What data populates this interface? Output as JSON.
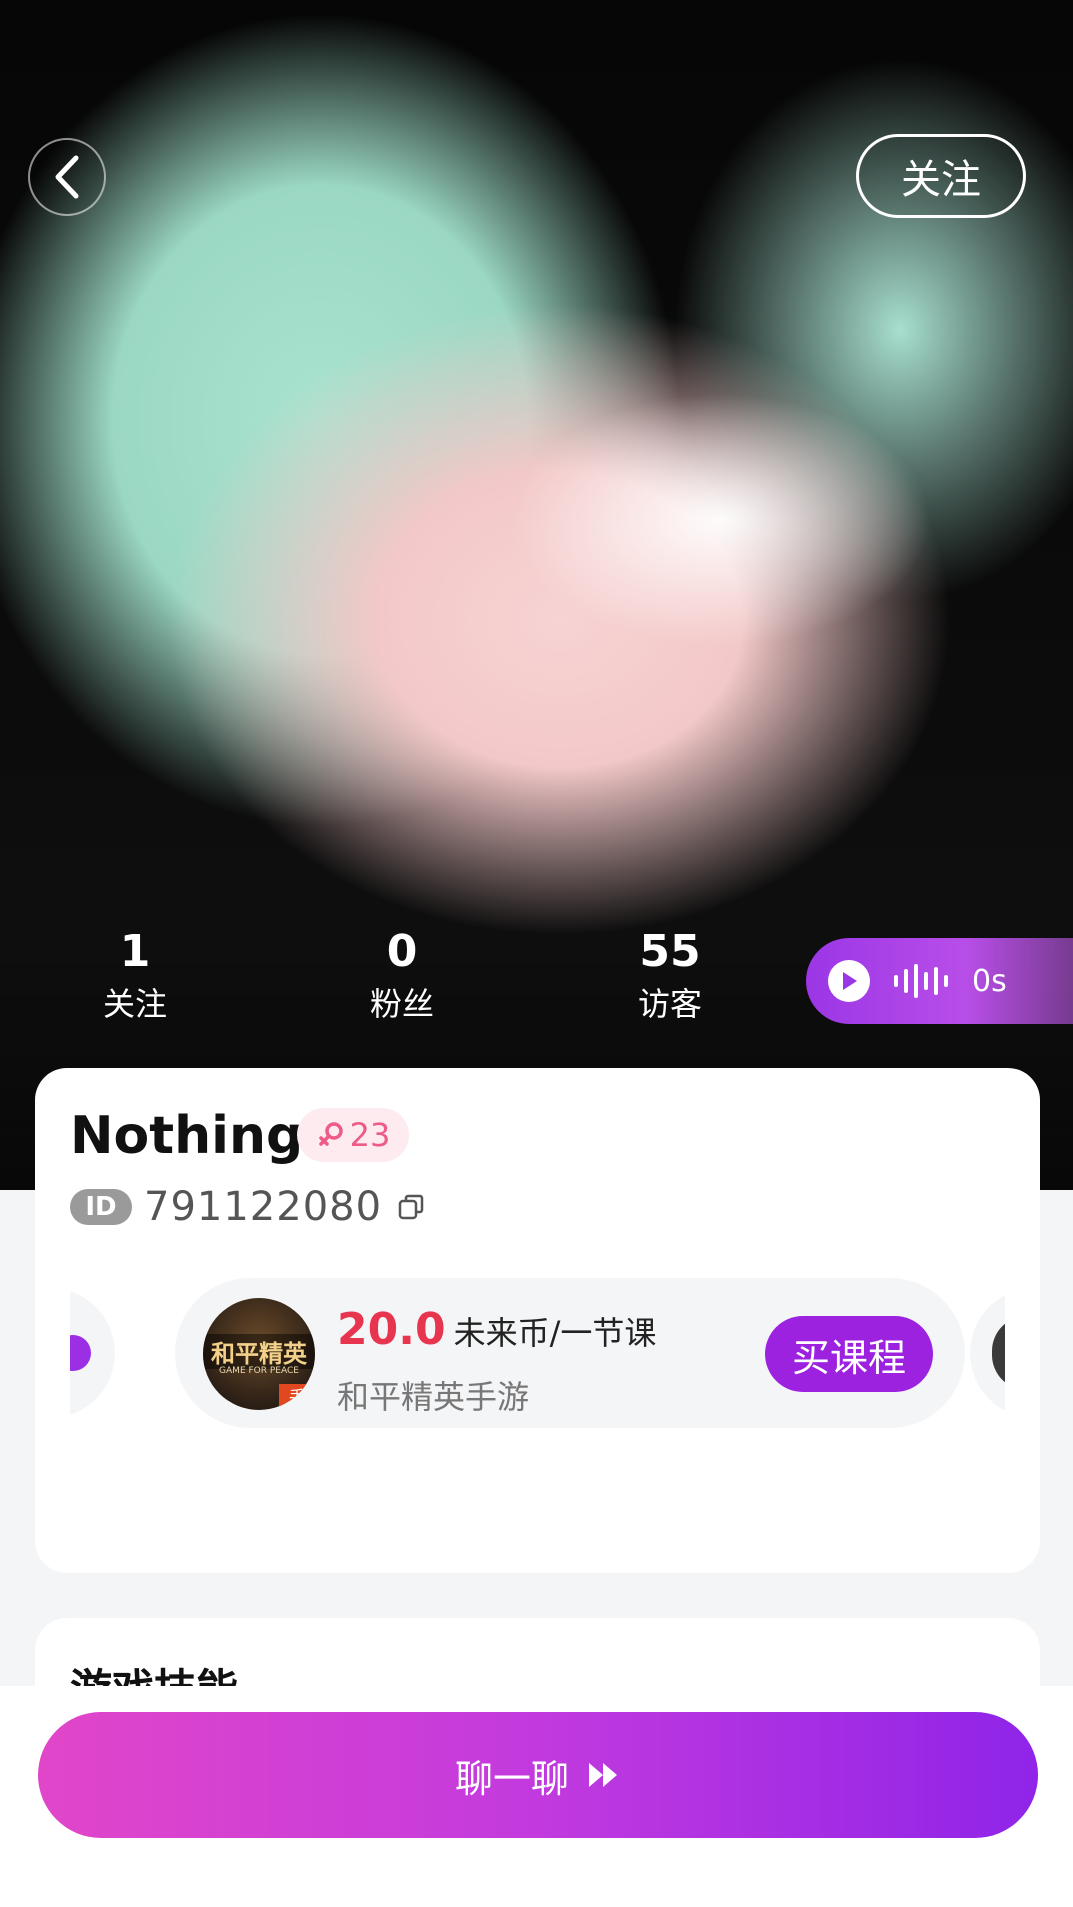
{
  "header": {
    "follow_label": "关注"
  },
  "stats": [
    {
      "value": "1",
      "label": "关注"
    },
    {
      "value": "0",
      "label": "粉丝"
    },
    {
      "value": "55",
      "label": "访客"
    }
  ],
  "voice": {
    "duration": "0s"
  },
  "profile": {
    "name": "Nothing",
    "age": "23",
    "id_tag": "ID",
    "id_number": "791122080"
  },
  "course": {
    "price": "20.0",
    "price_unit": "未来币/一节课",
    "game_name": "和平精英手游",
    "icon_title": "和平精英",
    "icon_subtitle": "GAME FOR PEACE",
    "icon_tag": "手",
    "buy_label": "买课程"
  },
  "skills": {
    "title": "游戏技能"
  },
  "bottom": {
    "chat_label": "聊一聊"
  },
  "colors": {
    "accent_purple": "#9c22e0",
    "price_red": "#e8354f",
    "age_pink": "#ee5b86"
  }
}
